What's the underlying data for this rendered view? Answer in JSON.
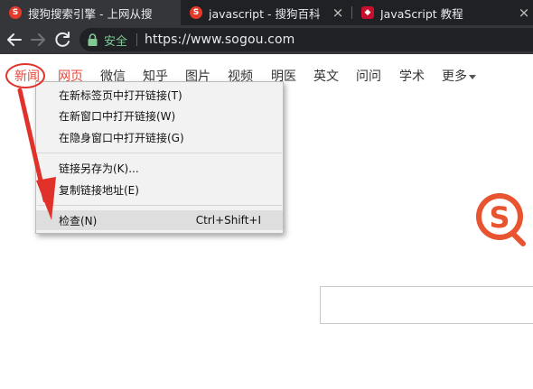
{
  "tabs": [
    {
      "title": "搜狗搜索引擎 - 上网从搜",
      "favicon": "sogou-icon",
      "favicon_glyph": "S",
      "active": true
    },
    {
      "title": "javascript - 搜狗百科",
      "favicon": "sogou-icon",
      "favicon_glyph": "S",
      "active": false
    },
    {
      "title": "JavaScript 教程",
      "favicon": "runoob-icon",
      "favicon_glyph": "◆",
      "active": false
    }
  ],
  "tab_close_glyph": "×",
  "toolbar": {
    "secure_label": "安全",
    "url": "https://www.sogou.com"
  },
  "page_nav": {
    "items": [
      "新闻",
      "网页",
      "微信",
      "知乎",
      "图片",
      "视频",
      "明医",
      "英文",
      "问问",
      "学术",
      "更多"
    ]
  },
  "context_menu": {
    "items": [
      {
        "label": "在新标签页中打开链接(T)",
        "shortcut": ""
      },
      {
        "label": "在新窗口中打开链接(W)",
        "shortcut": ""
      },
      {
        "label": "在隐身窗口中打开链接(G)",
        "shortcut": ""
      },
      {
        "label": "链接另存为(K)...",
        "shortcut": ""
      },
      {
        "label": "复制链接地址(E)",
        "shortcut": ""
      },
      {
        "label": "检查(N)",
        "shortcut": "Ctrl+Shift+I"
      }
    ]
  },
  "colors": {
    "accent_red": "#e54a3c",
    "secure_green": "#81c995",
    "tab_bar": "#202124",
    "toolbar": "#35363a"
  }
}
